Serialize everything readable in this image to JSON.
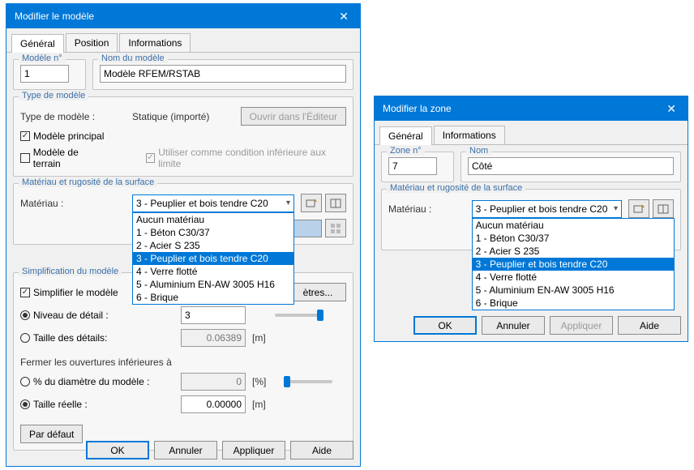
{
  "left": {
    "title": "Modifier le modèle",
    "tabs": [
      "Général",
      "Position",
      "Informations"
    ],
    "group_model": {
      "title": "Modèle n°",
      "value": "1"
    },
    "group_name": {
      "title": "Nom du modèle",
      "value": "Modèle RFEM/RSTAB"
    },
    "group_type": {
      "title": "Type de modèle",
      "type_label": "Type de modèle :",
      "type_value": "Statique (importé)",
      "open_editor": "Ouvrir dans l'Éditeur",
      "principal": "Modèle principal",
      "terrain": "Modèle de terrain",
      "use_condition": "Utiliser comme condition inférieure aux limite"
    },
    "group_material": {
      "title": "Matériau et rugosité de la surface",
      "material_label": "Matériau :",
      "material_value": "3 - Peuplier et bois tendre C20",
      "options": [
        "Aucun matériau",
        "1 - Béton C30/37",
        "2 - Acier S 235",
        "3 - Peuplier et bois tendre C20",
        "4 - Verre flotté",
        "5 - Aluminium EN-AW 3005 H16",
        "6 - Brique"
      ]
    },
    "group_simplify": {
      "title": "Simplification du modèle",
      "simplify": "Simplifier le modèle",
      "params_btn": "ètres...",
      "detail_level": "Niveau de détail :",
      "detail_value": "3",
      "detail_size": "Taille des détails:",
      "detail_size_value": "0.06389",
      "unit_m": "[m]",
      "close_openings": "Fermer les ouvertures inférieures à",
      "pct_model": "% du diamètre du modèle :",
      "pct_value": "0",
      "unit_pct": "[%]",
      "real_size": "Taille réelle :",
      "real_value": "0.00000"
    },
    "default_btn": "Par défaut",
    "buttons": {
      "ok": "OK",
      "cancel": "Annuler",
      "apply": "Appliquer",
      "help": "Aide"
    }
  },
  "right": {
    "title": "Modifier la zone",
    "tabs": [
      "Général",
      "Informations"
    ],
    "group_zone": {
      "title": "Zone n°",
      "value": "7"
    },
    "group_name": {
      "title": "Nom",
      "value": "Côté"
    },
    "group_material": {
      "title": "Matériau et rugosité de la surface",
      "material_label": "Matériau :",
      "material_value": "3 - Peuplier et bois tendre C20",
      "options": [
        "Aucun matériau",
        "1 - Béton C30/37",
        "2 - Acier S 235",
        "3 - Peuplier et bois tendre C20",
        "4 - Verre flotté",
        "5 - Aluminium EN-AW 3005 H16",
        "6 - Brique"
      ],
      "color": "#f5c78d"
    },
    "buttons": {
      "ok": "OK",
      "cancel": "Annuler",
      "apply": "Appliquer",
      "help": "Aide"
    }
  }
}
